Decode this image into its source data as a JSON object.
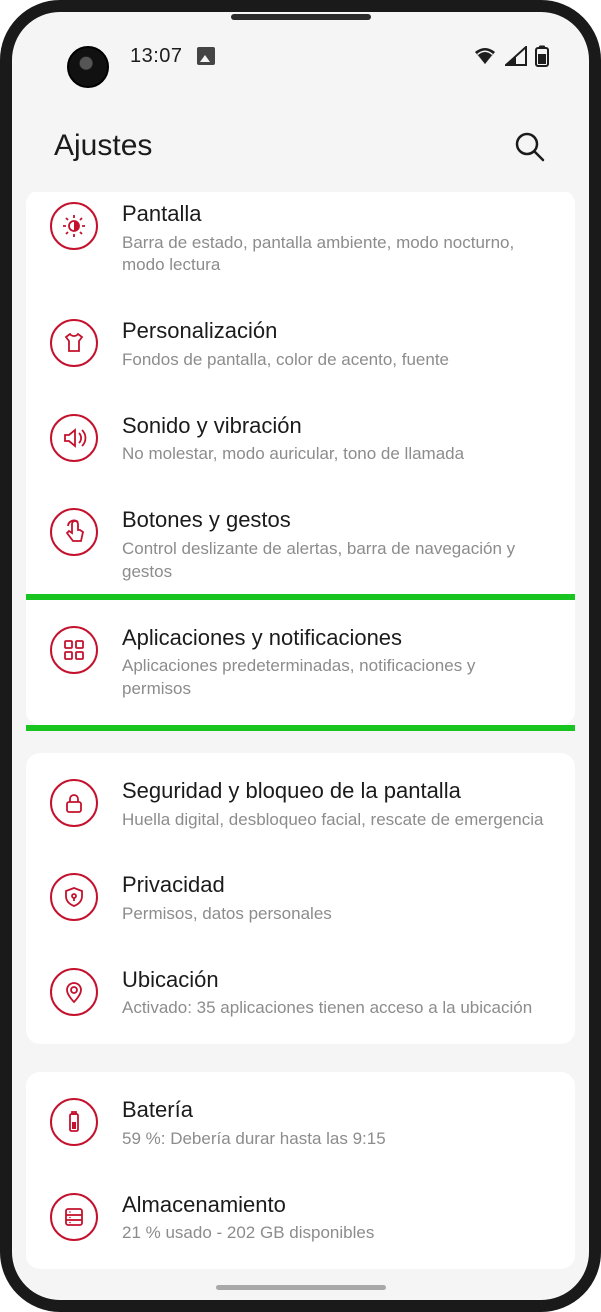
{
  "statusbar": {
    "time": "13:07"
  },
  "header": {
    "title": "Ajustes"
  },
  "groups": [
    {
      "items": [
        {
          "icon": "brightness",
          "title": "Pantalla",
          "sub": "Barra de estado, pantalla ambiente, modo nocturno, modo lectura"
        },
        {
          "icon": "tshirt",
          "title": "Personalización",
          "sub": "Fondos de pantalla, color de acento, fuente"
        },
        {
          "icon": "sound",
          "title": "Sonido y vibración",
          "sub": "No molestar, modo auricular, tono de llamada"
        },
        {
          "icon": "gesture",
          "title": "Botones y gestos",
          "sub": "Control deslizante de alertas, barra de navegación y gestos"
        },
        {
          "icon": "apps",
          "title": "Aplicaciones y notificaciones",
          "sub": "Aplicaciones predeterminadas, notificaciones y permisos",
          "highlighted": true
        }
      ]
    },
    {
      "items": [
        {
          "icon": "lock",
          "title": "Seguridad y bloqueo de la pantalla",
          "sub": "Huella digital, desbloqueo facial, rescate de emergencia"
        },
        {
          "icon": "privacy",
          "title": "Privacidad",
          "sub": "Permisos, datos personales"
        },
        {
          "icon": "location",
          "title": "Ubicación",
          "sub": "Activado: 35 aplicaciones tienen acceso a la ubicación"
        }
      ]
    },
    {
      "items": [
        {
          "icon": "battery",
          "title": "Batería",
          "sub": "59 %: Debería durar hasta las 9:15"
        },
        {
          "icon": "storage",
          "title": "Almacenamiento",
          "sub": "21 % usado - 202 GB disponibles"
        }
      ]
    }
  ]
}
